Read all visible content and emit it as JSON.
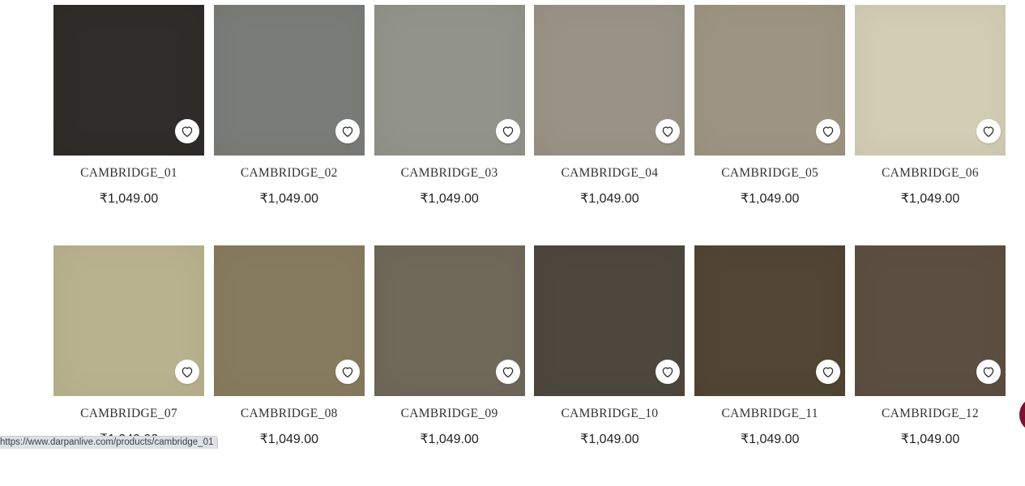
{
  "products": [
    {
      "name": "CAMBRIDGE_01",
      "price": "₹1,049.00",
      "color": "#2e2d29"
    },
    {
      "name": "CAMBRIDGE_02",
      "price": "₹1,049.00",
      "color": "#7a7c77"
    },
    {
      "name": "CAMBRIDGE_03",
      "price": "₹1,049.00",
      "color": "#92938a"
    },
    {
      "name": "CAMBRIDGE_04",
      "price": "₹1,049.00",
      "color": "#989385"
    },
    {
      "name": "CAMBRIDGE_05",
      "price": "₹1,049.00",
      "color": "#9d9581"
    },
    {
      "name": "CAMBRIDGE_06",
      "price": "₹1,049.00",
      "color": "#d3cdb5"
    },
    {
      "name": "CAMBRIDGE_07",
      "price": "₹1,049.00",
      "color": "#b8b28e"
    },
    {
      "name": "CAMBRIDGE_08",
      "price": "₹1,049.00",
      "color": "#877b5f"
    },
    {
      "name": "CAMBRIDGE_09",
      "price": "₹1,049.00",
      "color": "#70695a"
    },
    {
      "name": "CAMBRIDGE_10",
      "price": "₹1,049.00",
      "color": "#4e473d"
    },
    {
      "name": "CAMBRIDGE_11",
      "price": "₹1,049.00",
      "color": "#514533"
    },
    {
      "name": "CAMBRIDGE_12",
      "price": "₹1,049.00",
      "color": "#5c4f41"
    }
  ],
  "wishlist_icon": "heart-outline-icon",
  "status_bar": {
    "url": "https://www.darpanlive.com/products/cambridge_01"
  },
  "chat_widget": {
    "color": "#7b1230"
  }
}
